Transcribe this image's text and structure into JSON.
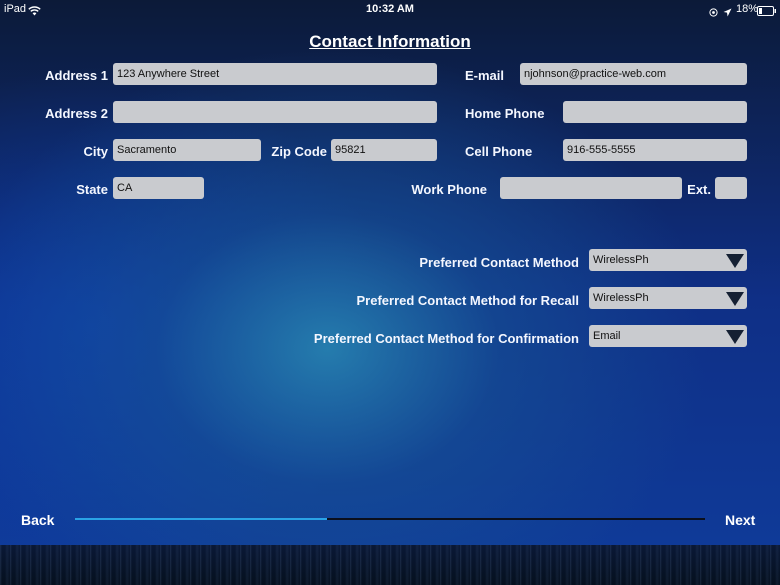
{
  "status_bar": {
    "device": "iPad",
    "time": "10:32 AM",
    "battery": "18%"
  },
  "title": "Contact Information",
  "fields": {
    "address1": {
      "label": "Address 1",
      "value": "123 Anywhere Street"
    },
    "address2": {
      "label": "Address 2",
      "value": ""
    },
    "city": {
      "label": "City",
      "value": "Sacramento"
    },
    "zip": {
      "label": "Zip Code",
      "value": "95821"
    },
    "state": {
      "label": "State",
      "value": "CA"
    },
    "email": {
      "label": "E-mail",
      "value": "njohnson@practice-web.com"
    },
    "home_phone": {
      "label": "Home Phone",
      "value": ""
    },
    "cell_phone": {
      "label": "Cell Phone",
      "value": "916-555-5555"
    },
    "work_phone": {
      "label": "Work Phone",
      "value": ""
    },
    "ext": {
      "label": "Ext.",
      "value": ""
    }
  },
  "preferences": {
    "contact": {
      "label": "Preferred Contact Method",
      "value": "WirelessPh"
    },
    "recall": {
      "label": "Preferred Contact Method for Recall",
      "value": "WirelessPh"
    },
    "confirmation": {
      "label": "Preferred Contact Method for Confirmation",
      "value": "Email"
    }
  },
  "nav": {
    "back": "Back",
    "next": "Next",
    "progress_percent": 40
  },
  "colors": {
    "progress_fill": "#2aa3e6",
    "field_bg": "#c9cbcf"
  },
  "icons": [
    "wifi-icon",
    "location-lock-icon",
    "location-arrow-icon",
    "battery-icon",
    "dropdown-arrow-icon"
  ]
}
